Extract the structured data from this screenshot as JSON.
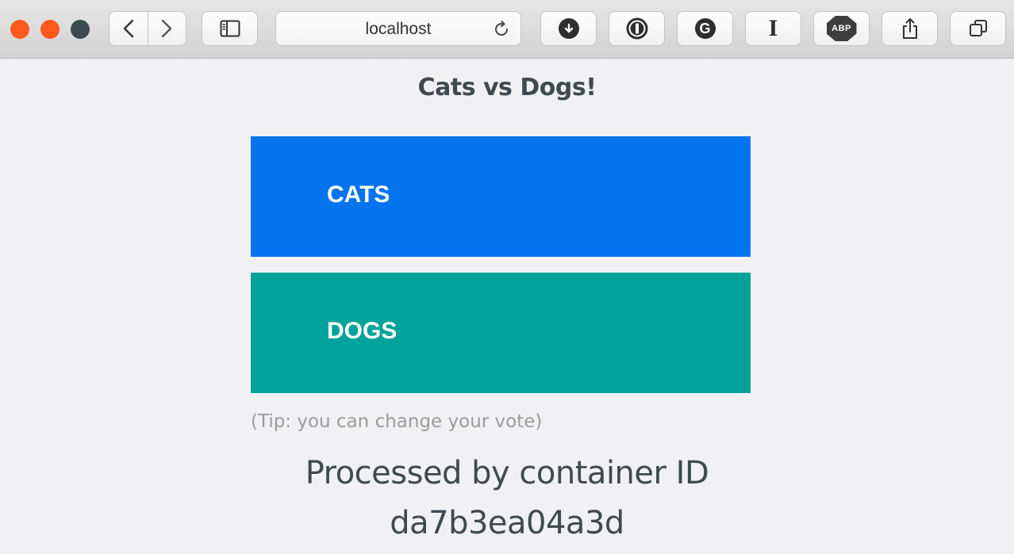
{
  "browser": {
    "address": "localhost",
    "traffic_colors": {
      "close": "#fc5a1c",
      "minimize": "#fc5a1c",
      "zoom": "#3c4a4f"
    },
    "icons": [
      "back-icon",
      "forward-icon",
      "sidebar-icon",
      "reload-icon",
      "download-icon",
      "onepassword-icon",
      "grammarly-icon",
      "instapaper-icon",
      "adblock-icon",
      "share-icon",
      "tabs-icon"
    ],
    "grammarly_glyph": "G",
    "instapaper_glyph": "I",
    "adblock_label": "ABP"
  },
  "page": {
    "title": "Cats vs Dogs!",
    "options": [
      {
        "label": "CATS",
        "color": "#0774ef"
      },
      {
        "label": "DOGS",
        "color": "#00a39a"
      }
    ],
    "tip": "(Tip: you can change your vote)",
    "processed_line1": "Processed by container ID",
    "processed_line2": "da7b3ea04a3d"
  }
}
